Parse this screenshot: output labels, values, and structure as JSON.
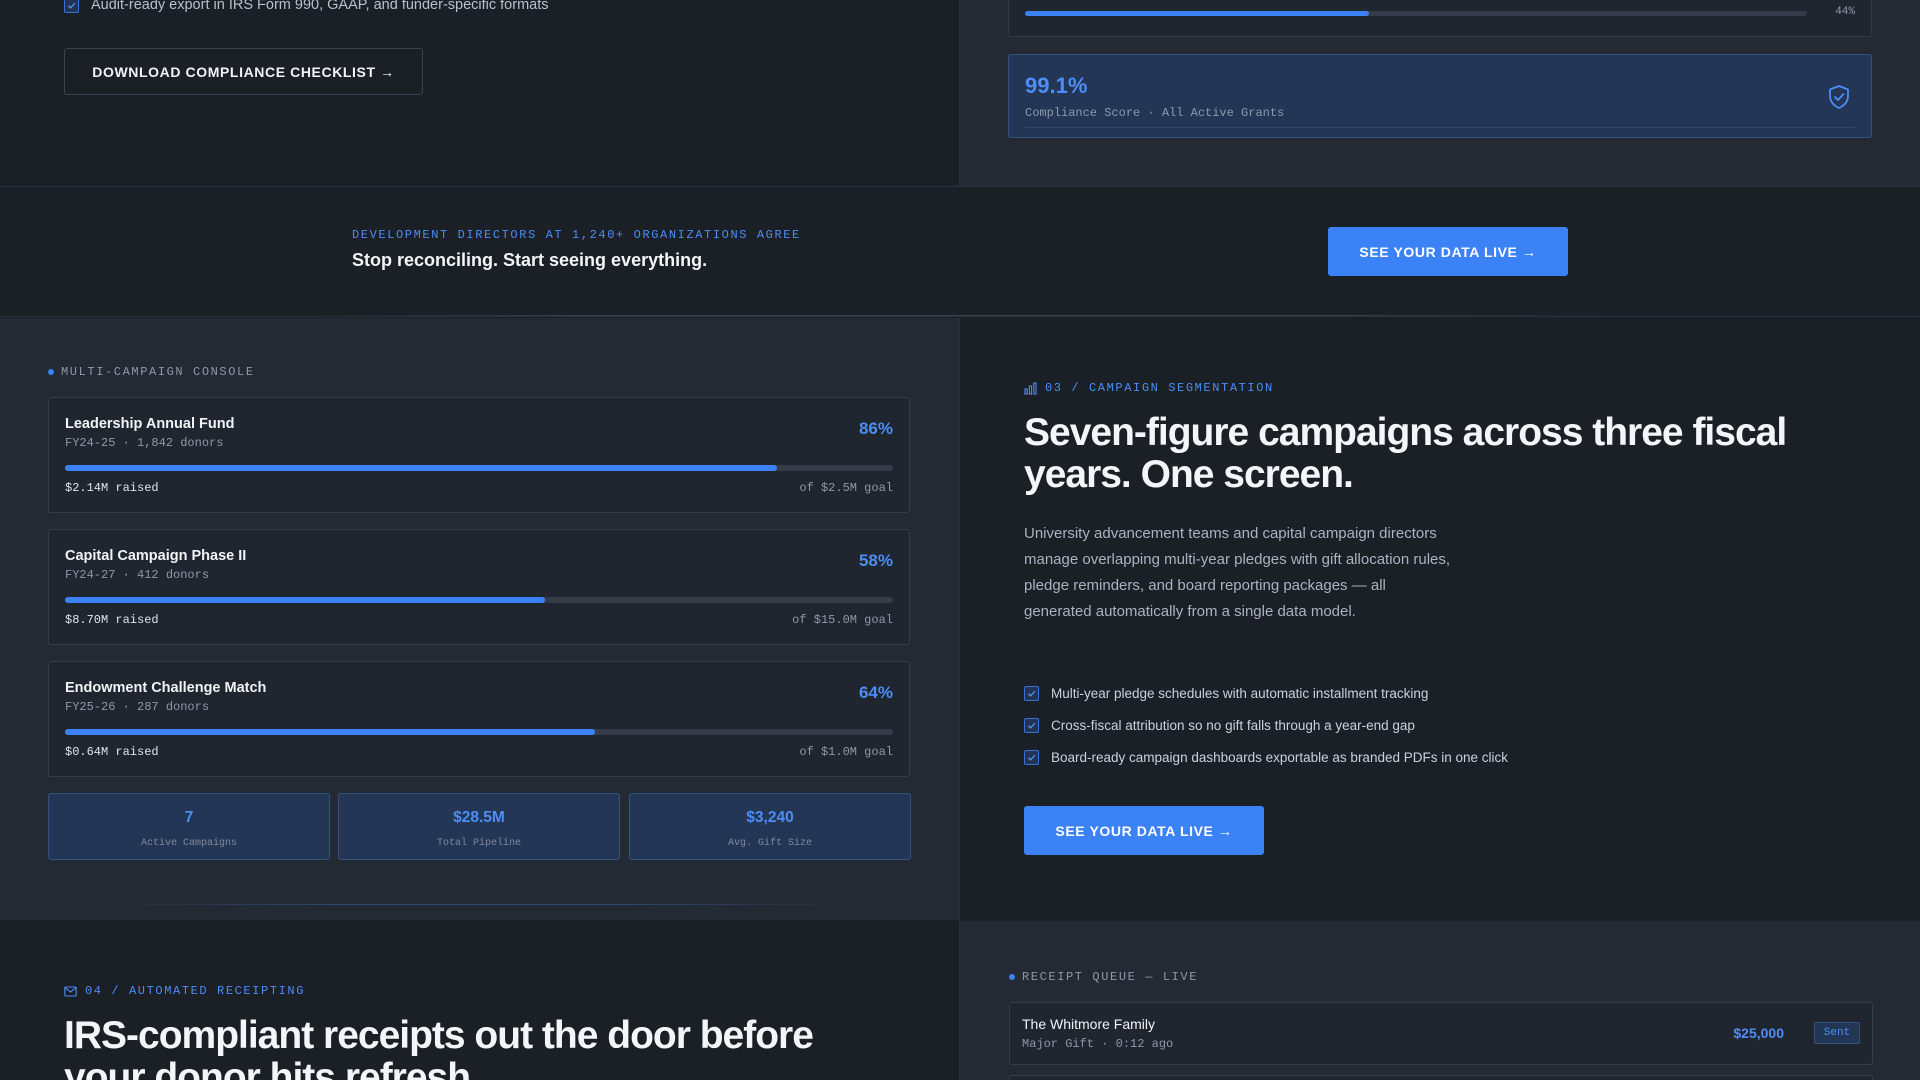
{
  "compliance": {
    "check_item": "Audit-ready export in IRS Form 990, GAAP, and funder-specific formats",
    "download_button": "DOWNLOAD COMPLIANCE CHECKLIST →",
    "progress_value": 0.44,
    "progress_label": "44%",
    "score_value": "99.1%",
    "score_label": "Compliance Score · All Active Grants",
    "shield_icon": "shield-check-icon"
  },
  "cta_band": {
    "eyebrow": "DEVELOPMENT DIRECTORS AT 1,240+ ORGANIZATIONS AGREE",
    "title": "Stop reconciling. Start seeing everything.",
    "button": "SEE YOUR DATA LIVE →"
  },
  "console": {
    "label": "MULTI-CAMPAIGN CONSOLE",
    "campaigns": [
      {
        "name": "Leadership Annual Fund",
        "meta": "FY24-25 · 1,842 donors",
        "pct_label": "86%",
        "progress": 0.86,
        "raised": "$2.14M raised",
        "goal": "of $2.5M goal"
      },
      {
        "name": "Capital Campaign Phase II",
        "meta": "FY24-27 · 412 donors",
        "pct_label": "58%",
        "progress": 0.58,
        "raised": "$8.70M raised",
        "goal": "of $15.0M goal"
      },
      {
        "name": "Endowment Challenge Match",
        "meta": "FY25-26 · 287 donors",
        "pct_label": "64%",
        "progress": 0.64,
        "raised": "$0.64M raised",
        "goal": "of $1.0M goal"
      }
    ],
    "stats": [
      {
        "value": "7",
        "label": "Active Campaigns"
      },
      {
        "value": "$28.5M",
        "label": "Total Pipeline"
      },
      {
        "value": "$3,240",
        "label": "Avg. Gift Size"
      }
    ]
  },
  "segmentation": {
    "eyebrow": "03 / CAMPAIGN SEGMENTATION",
    "eyebrow_icon": "bar-chart-icon",
    "title": "Seven-figure campaigns across three fiscal years. One screen.",
    "body": "University advancement teams and capital campaign directors manage overlapping multi-year pledges with gift allocation rules, pledge reminders, and board reporting packages — all generated automatically from a single data model.",
    "checks": [
      "Multi-year pledge schedules with automatic installment tracking",
      "Cross-fiscal attribution so no gift falls through a year-end gap",
      "Board-ready campaign dashboards exportable as branded PDFs in one click"
    ],
    "button": "SEE YOUR DATA LIVE →"
  },
  "receipting": {
    "eyebrow": "04 / AUTOMATED RECEIPTING",
    "eyebrow_icon": "mail-icon",
    "title": "IRS-compliant receipts out the door before your donor hits refresh."
  },
  "queue": {
    "label": "RECEIPT QUEUE — LIVE",
    "rows": [
      {
        "name": "The Whitmore Family",
        "meta": "Major Gift · 0:12 ago",
        "amount": "$25,000",
        "status": "Sent"
      }
    ]
  },
  "colors": {
    "accent": "#3b82f6",
    "accent_text": "#4c8df6",
    "bg_dark": "#1b1f26",
    "bg_panel": "#232a34"
  }
}
